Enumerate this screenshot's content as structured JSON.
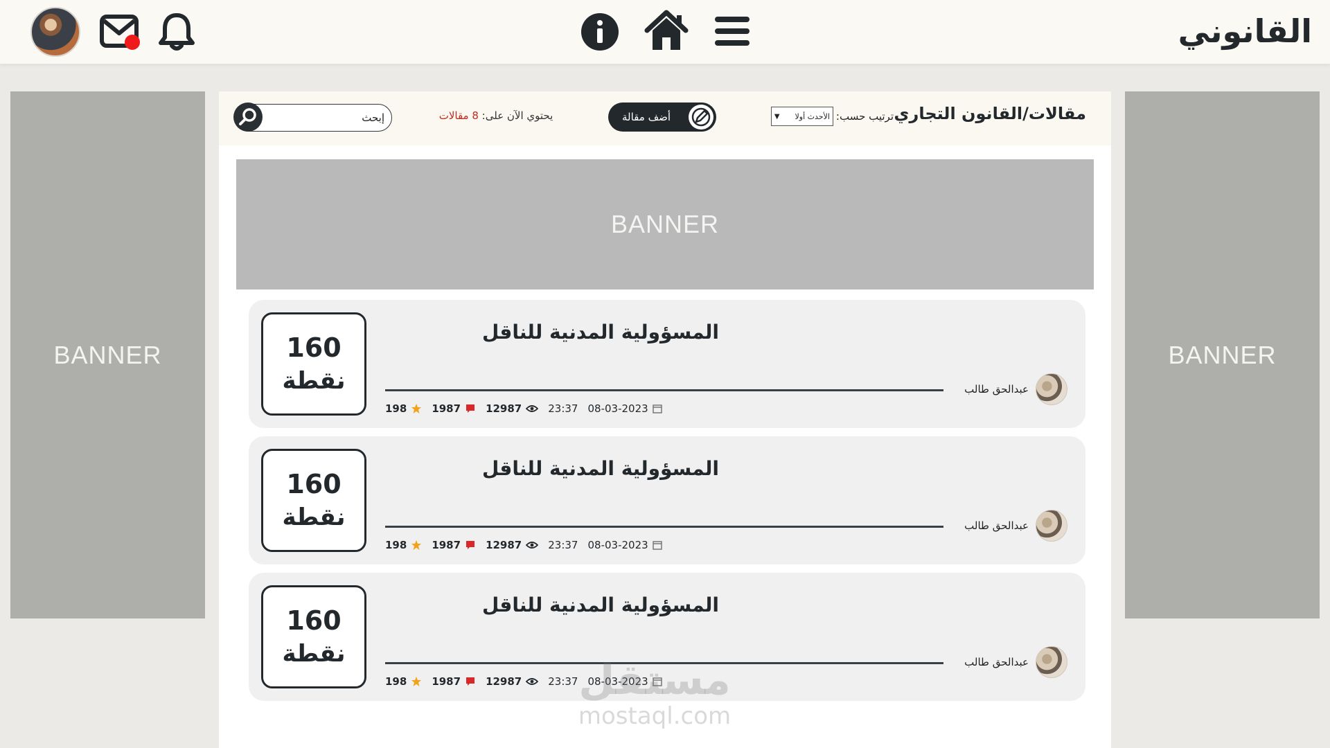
{
  "header": {
    "brand": "القانوني",
    "icons": [
      "avatar",
      "mail-icon",
      "notification-dot",
      "bell-icon",
      "info-icon",
      "home-icon",
      "menu-icon"
    ]
  },
  "toolbar": {
    "page_title": "مقالات/القانون التجاري",
    "sort_label": "ترتيب حسب:",
    "sort_selected": "الأحدث أولا",
    "add_article_label": "أضف مقالة",
    "count_prefix": "يحتوي الآن على:",
    "count_value": "8 مقالات",
    "search_placeholder": "إبحث"
  },
  "banners": {
    "left": "BANNER",
    "right": "BANNER",
    "top": "BANNER"
  },
  "articles": [
    {
      "points": "160",
      "points_label": "نقطة",
      "title": "المسؤولية المدنية للناقل",
      "author": "عبدالحق طالب",
      "date": "08-03-2023",
      "time": "23:37",
      "views": "12987",
      "comments": "1987",
      "stars": "198"
    },
    {
      "points": "160",
      "points_label": "نقطة",
      "title": "المسؤولية المدنية للناقل",
      "author": "عبدالحق طالب",
      "date": "08-03-2023",
      "time": "23:37",
      "views": "12987",
      "comments": "1987",
      "stars": "198"
    },
    {
      "points": "160",
      "points_label": "نقطة",
      "title": "المسؤولية المدنية للناقل",
      "author": "عبدالحق طالب",
      "date": "08-03-2023",
      "time": "23:37",
      "views": "12987",
      "comments": "1987",
      "stars": "198"
    }
  ],
  "watermark": {
    "arabic": "مستقل",
    "latin": "mostaql.com"
  },
  "colors": {
    "header_bg": "#fbf9f4",
    "page_bg": "#eceae6",
    "dark": "#23282d",
    "accent_red": "#c02a1f",
    "notification_dot": "#ef1b1b",
    "star": "#f2a31b",
    "banner_gray": "#aeaeaa"
  }
}
